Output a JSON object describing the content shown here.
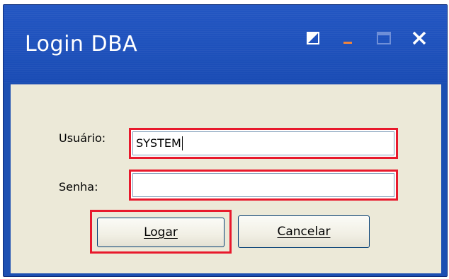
{
  "window": {
    "title": "Login DBA"
  },
  "titlebar_buttons": {
    "restore_icon": "restore-toggle-icon",
    "minimize_icon": "minimize-icon",
    "maximize_icon": "maximize-icon",
    "close_icon": "close-icon"
  },
  "form": {
    "user_label": "Usuário:",
    "user_value": "SYSTEM",
    "password_label": "Senha:",
    "password_value": ""
  },
  "buttons": {
    "login_label": "Logar",
    "cancel_label": "Cancelar"
  },
  "colors": {
    "titlebar": "#1f52bd",
    "client_bg": "#ece9d8",
    "highlight": "#e8192c",
    "minimize_accent": "#f0843c"
  }
}
